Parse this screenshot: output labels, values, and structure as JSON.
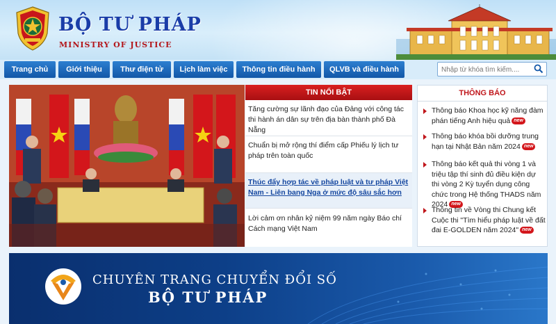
{
  "header": {
    "title": "BỘ TƯ PHÁP",
    "subtitle": "MINISTRY OF JUSTICE"
  },
  "nav": {
    "items": [
      {
        "label": "Trang chủ"
      },
      {
        "label": "Giới thiệu"
      },
      {
        "label": "Thư điện tử"
      },
      {
        "label": "Lịch làm việc"
      },
      {
        "label": "Thông tin điều hành"
      },
      {
        "label": "QLVB và điều hành"
      }
    ],
    "search_placeholder": "Nhập từ khóa tìm kiếm...."
  },
  "featured": {
    "heading": "TIN NỔI BẬT",
    "items": [
      {
        "text": "Tăng cường sự lãnh đạo của Đảng với công tác thi hành án dân sự trên địa bàn thành phố Đà Nẵng"
      },
      {
        "text": "Chuẩn bị mở rộng thí điểm cấp Phiếu lý lịch tư pháp trên toàn quốc"
      },
      {
        "text": "Thúc đẩy hợp tác về pháp luật và tư pháp Việt Nam - Liên bang Nga ở mức độ sâu sắc hơn"
      },
      {
        "text": "Lời cảm ơn nhân kỷ niệm 99 năm ngày Báo chí Cách mạng Việt Nam"
      }
    ]
  },
  "notices": {
    "heading": "THÔNG BÁO",
    "new_label": "new",
    "items": [
      {
        "text": "Thông báo Khoa học kỹ năng đàm phán tiếng Anh hiệu quả"
      },
      {
        "text": "Thông báo khóa bồi dưỡng trung hạn tại Nhật Bản năm 2024"
      },
      {
        "text": "Thông báo kết quả thi vòng 1 và triệu tập thí sinh đủ điều kiện dự thi vòng 2 Kỳ tuyển dụng công chức trong Hệ thống THADS năm 2024"
      },
      {
        "text": "Thông tin về Vòng thi Chung kết Cuộc thi \"Tìm hiểu pháp luật về đất đai E-GOLDEN năm 2024\""
      }
    ]
  },
  "banner": {
    "line1": "CHUYÊN TRANG CHUYỂN ĐỔI SỐ",
    "line2": "BỘ TƯ PHÁP"
  },
  "colors": {
    "nav_blue": "#1257a8",
    "accent_red": "#c0161b",
    "title_blue": "#1a3da8"
  }
}
